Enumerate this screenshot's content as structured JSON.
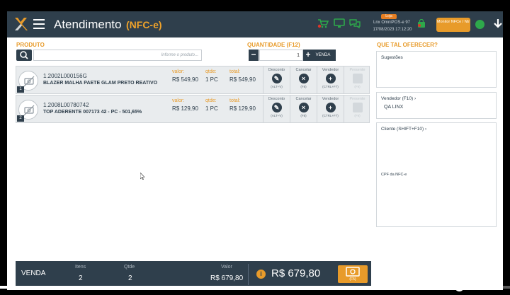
{
  "header": {
    "title": "Atendimento",
    "subtitle": "(NFC-e)",
    "store_badge": "Loja",
    "store_name": "Lnx OmniPOS-e 97",
    "store_datetime": "17/08/2023 17:12:20",
    "monitor_label": "Monitor NFCe / Ntr"
  },
  "produto": {
    "label": "PRODUTO",
    "search_placeholder": "Informe o produto..."
  },
  "quantidade": {
    "label": "QUANTIDADE (F12)",
    "value": "1",
    "minus": "−",
    "plus": "+",
    "venda_button": "VENDA"
  },
  "items": [
    {
      "index": "1",
      "code": "1.2002L000156G",
      "description": "BLAZER MALHA PAETE GLAM PRETO REATIVO",
      "valor_label": "valor:",
      "valor": "R$ 549,90",
      "qtde_label": "qtde:",
      "qtde": "1 PC",
      "total_label": "total:",
      "total": "R$ 549,90"
    },
    {
      "index": "2",
      "code": "1.2008L00780742",
      "description": "TOP ADERENTE 007173 42 - PC - 501,65%",
      "valor_label": "valor:",
      "valor": "R$ 129,90",
      "qtde_label": "qtde:",
      "qtde": "1 PC",
      "total_label": "total:",
      "total": "R$ 129,90"
    }
  ],
  "row_actions": {
    "desconto": {
      "label": "Desconto",
      "key": "(ALT+V)"
    },
    "cancelar": {
      "label": "Cancelar",
      "key": "(F8)"
    },
    "vendedor": {
      "label": "Vendedor",
      "key": "(CTRL+F7)"
    },
    "presente": {
      "label": "Presente",
      "key": "(F9)"
    }
  },
  "right": {
    "title": "QUE TAL OFERECER?",
    "sugestoes_label": "Sugestões",
    "vendedor_label": "Vendedor (F10)",
    "vendedor_value": "QA LINX",
    "cliente_label": "Cliente (SHIFT+F10)",
    "cpf_label": "CPF da NFC-e"
  },
  "footer": {
    "venda_label": "VENDA",
    "itens_label": "Itens",
    "itens_value": "2",
    "qtde_label": "Qtde",
    "qtde_value": "2",
    "valor_label": "Valor",
    "valor_value": "R$ 679,80",
    "total": "R$ 679,80",
    "info_icon": "i",
    "pay_key": "(F5)"
  },
  "video": {
    "progress": 0.9
  },
  "colors": {
    "header": "#2f3f4c",
    "accent": "#e89b2a",
    "row_bg": "#e9ecee"
  }
}
